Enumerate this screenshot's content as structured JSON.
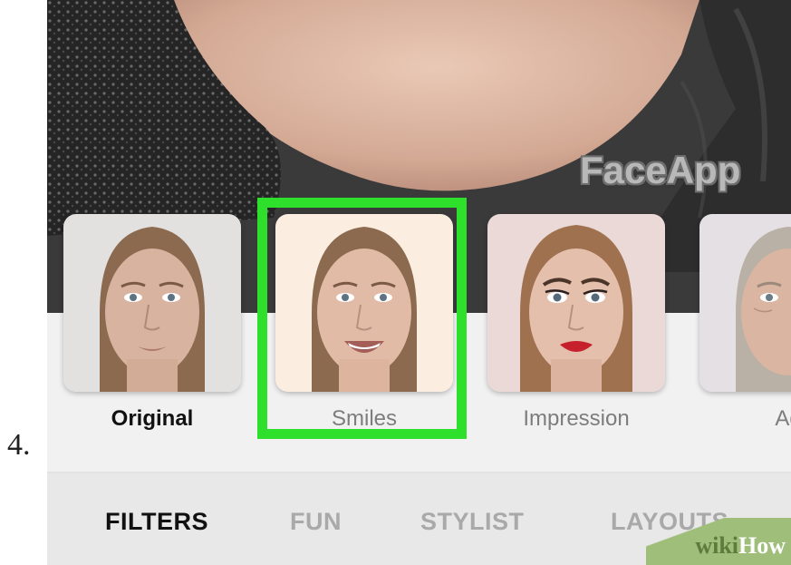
{
  "step_number": "4.",
  "photo": {
    "watermark": "FaceApp"
  },
  "filters": [
    {
      "label": "Original",
      "active": true
    },
    {
      "label": "Smiles",
      "active": false,
      "highlighted": true
    },
    {
      "label": "Impression",
      "active": false
    },
    {
      "label": "Ag",
      "active": false
    }
  ],
  "tabs": [
    {
      "label": "FILTERS",
      "active": true
    },
    {
      "label": "FUN",
      "active": false
    },
    {
      "label": "STYLIST",
      "active": false
    },
    {
      "label": "LAYOUTS",
      "active": false
    }
  ],
  "watermark_badge": {
    "prefix": "wiki",
    "suffix": "How"
  },
  "colors": {
    "highlight": "#2ee02c",
    "tabbar_bg": "#e8e8e8",
    "active_tab": "#111111",
    "inactive_tab": "#a9a9a9",
    "wikihow_green": "#9fbe7a"
  }
}
